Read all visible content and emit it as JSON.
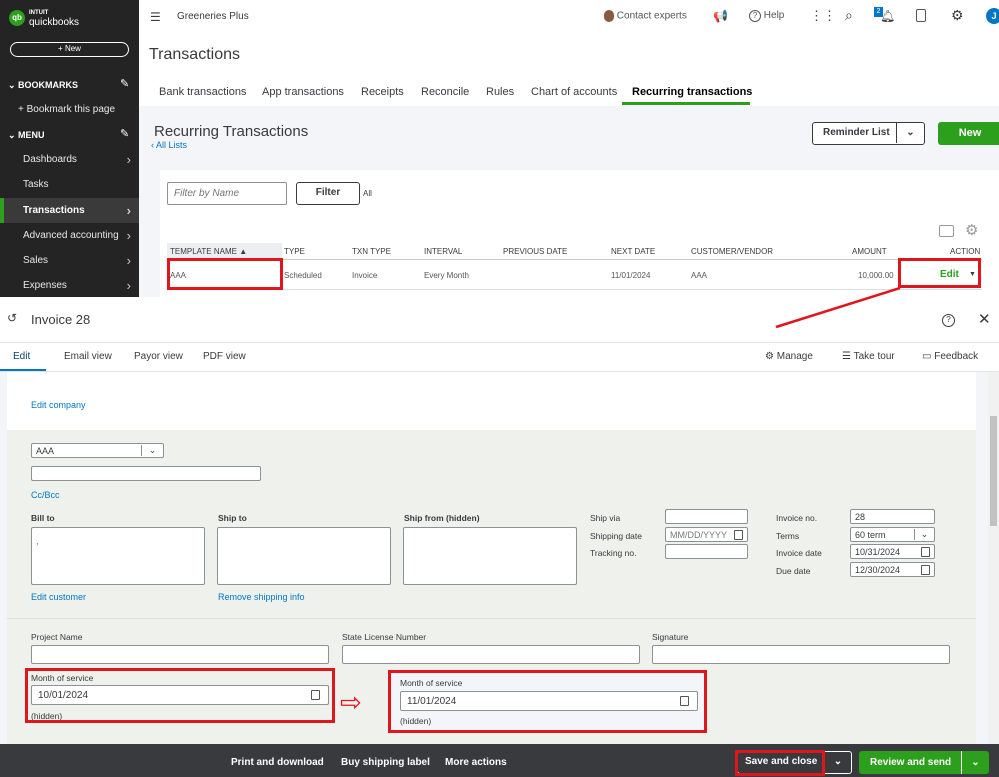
{
  "brand": {
    "line1": "INTUIT",
    "line2": "quickbooks"
  },
  "sidebar": {
    "new_label": "+ New",
    "bookmarks": "BOOKMARKS",
    "bookmark_this": "Bookmark this page",
    "menu": "MENU",
    "items": [
      {
        "label": "Dashboards"
      },
      {
        "label": "Tasks"
      },
      {
        "label": "Transactions"
      },
      {
        "label": "Advanced accounting"
      },
      {
        "label": "Sales"
      },
      {
        "label": "Expenses"
      }
    ]
  },
  "header": {
    "company": "Greeneries Plus",
    "contact": "Contact experts",
    "help": "Help",
    "notif_count": "2",
    "avatar": "J"
  },
  "page": {
    "title": "Transactions",
    "tabs": [
      "Bank transactions",
      "App transactions",
      "Receipts",
      "Reconcile",
      "Rules",
      "Chart of accounts",
      "Recurring transactions"
    ]
  },
  "recurring": {
    "title": "Recurring Transactions",
    "all_lists": "All Lists",
    "reminder_list": "Reminder List",
    "new": "New",
    "filter_placeholder": "Filter by Name",
    "filter": "Filter",
    "all": "All",
    "columns": [
      "TEMPLATE NAME ▲",
      "TYPE",
      "TXN TYPE",
      "INTERVAL",
      "PREVIOUS DATE",
      "NEXT DATE",
      "CUSTOMER/VENDOR",
      "AMOUNT",
      "ACTION"
    ],
    "row": {
      "name": "AAA",
      "type": "Scheduled",
      "txn_type": "Invoice",
      "interval": "Every Month",
      "previous_date": "",
      "next_date": "11/01/2024",
      "customer": "AAA",
      "amount": "10,000.00",
      "action": "Edit"
    }
  },
  "invoice": {
    "title": "Invoice 28",
    "tabs": [
      "Edit",
      "Email view",
      "Payor view",
      "PDF view"
    ],
    "manage": "Manage",
    "take_tour": "Take tour",
    "feedback": "Feedback",
    "edit_company": "Edit company",
    "customer": "AAA",
    "cc_bcc": "Cc/Bcc",
    "bill_to": "Bill to",
    "bill_to_value": ",",
    "ship_to": "Ship to",
    "ship_from": "Ship from (hidden)",
    "edit_customer": "Edit customer",
    "remove_shipping": "Remove shipping info",
    "ship_via": "Ship via",
    "shipping_date": "Shipping date",
    "shipping_date_ph": "MM/DD/YYYY",
    "tracking_no": "Tracking no.",
    "invoice_no_label": "Invoice no.",
    "invoice_no": "28",
    "terms_label": "Terms",
    "terms": "60 term",
    "invoice_date_label": "Invoice date",
    "invoice_date": "10/31/2024",
    "due_date_label": "Due date",
    "due_date": "12/30/2024",
    "project_name": "Project Name",
    "state_license": "State License Number",
    "signature": "Signature",
    "month_of_service": "Month of service",
    "month_before": "10/01/2024",
    "month_after": "11/01/2024",
    "hidden": "(hidden)"
  },
  "footer": {
    "print": "Print and download",
    "shipping_label": "Buy shipping label",
    "more": "More actions",
    "save_close": "Save and close",
    "review_send": "Review and send"
  },
  "colors": {
    "green": "#2ca01c",
    "red": "#e0161d",
    "link": "#0077c5"
  }
}
